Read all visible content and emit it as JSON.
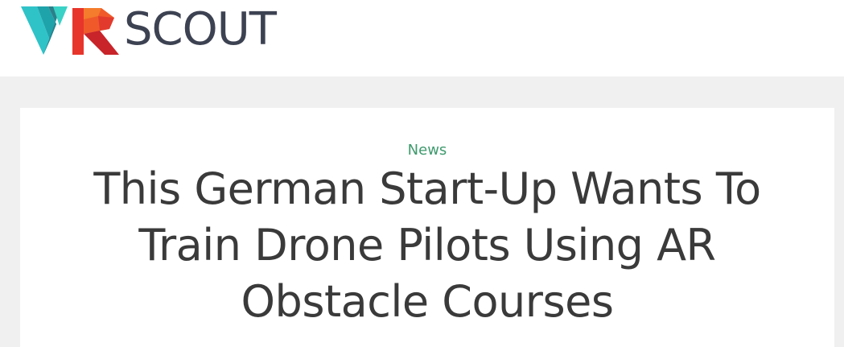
{
  "site": {
    "logo_text": "SCOUT",
    "logo_mark_letters": "VR",
    "colors": {
      "brand_teal": "#2fc3c8",
      "brand_red": "#e8352b",
      "logo_text": "#3d4252",
      "category_green": "#3f9a6e",
      "headline": "#3a3a3a",
      "page_bg": "#f0f0f0"
    }
  },
  "article": {
    "category": "News",
    "title": "This German Start-Up Wants To Train Drone Pilots Using AR Obstacle Courses"
  }
}
